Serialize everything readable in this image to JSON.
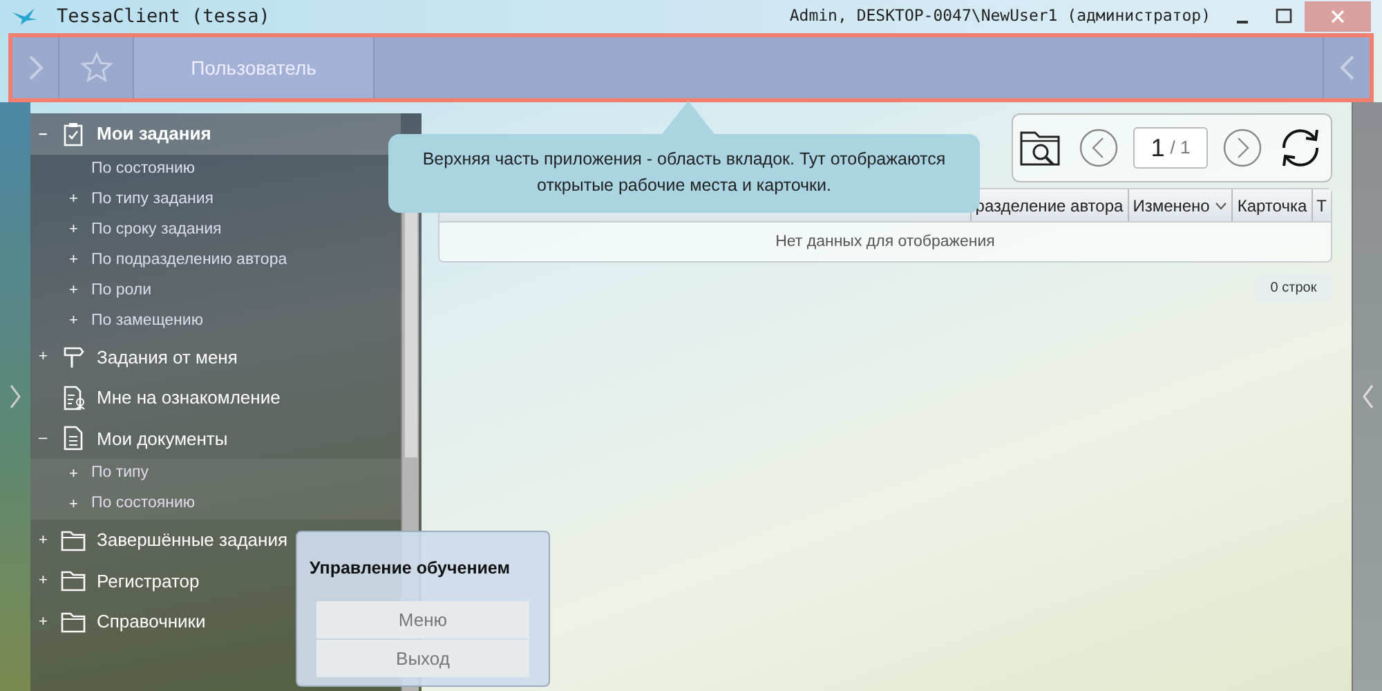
{
  "window": {
    "title": "TessaClient (tessa)",
    "user": "Admin, DESKTOP-0047\\NewUser1 (администратор)"
  },
  "tabs": [
    {
      "label": "Пользователь"
    }
  ],
  "tree": [
    {
      "label": "Мои задания",
      "expander": "–",
      "kind": "clipboard",
      "selected": true,
      "children": [
        {
          "label": "По состоянию"
        },
        {
          "label": "По типу задания",
          "expander": "+"
        },
        {
          "label": "По сроку задания",
          "expander": "+"
        },
        {
          "label": "По подразделению автора",
          "expander": "+"
        },
        {
          "label": "По роли",
          "expander": "+"
        },
        {
          "label": "По замещению",
          "expander": "+"
        }
      ]
    },
    {
      "label": "Задания от меня",
      "expander": "+",
      "kind": "signpost",
      "selected": false
    },
    {
      "label": "Мне на ознакомление",
      "kind": "review",
      "selected": false
    },
    {
      "label": "Мои документы",
      "expander": "–",
      "kind": "document",
      "selected": false,
      "children": [
        {
          "label": "По типу",
          "expander": "+"
        },
        {
          "label": "По состоянию",
          "expander": "+"
        }
      ]
    },
    {
      "label": "Завершённые задания",
      "expander": "+",
      "kind": "folder",
      "selected": false
    },
    {
      "label": "Регистратор",
      "expander": "+",
      "kind": "folder",
      "selected": false
    },
    {
      "label": "Справочники",
      "expander": "+",
      "kind": "folder",
      "selected": false
    }
  ],
  "paging": {
    "page": "1",
    "total": "/ 1"
  },
  "table": {
    "columns": [
      {
        "label": "разделение автора",
        "sorted": false
      },
      {
        "label": "Изменено",
        "sorted": true
      },
      {
        "label": "Карточка",
        "sorted": false
      },
      {
        "label": "Т",
        "sorted": false
      }
    ],
    "empty_text": "Нет данных для отображения"
  },
  "row_count": "0 строк",
  "tooltip": {
    "text": "Верхняя часть приложения - область вкладок. Тут отображаются открытые рабочие места и карточки."
  },
  "learning_panel": {
    "title": "Управление обучением",
    "buttons": [
      {
        "label": "Меню",
        "disabled": true
      },
      {
        "label": "Выход",
        "disabled": true
      }
    ]
  }
}
